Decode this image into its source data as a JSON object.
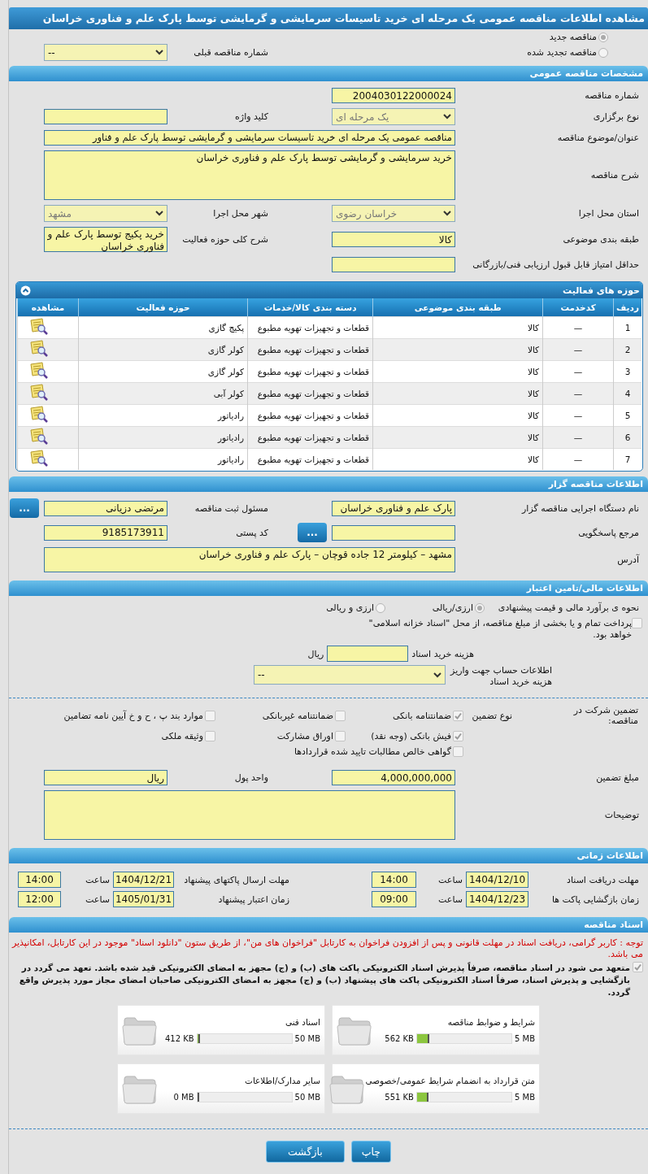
{
  "title": "مشاهده اطلاعات مناقصه عمومی یک مرحله ای خرید تاسیسات سرمایشی و گرمایشی توسط پارک علم و فناوری خراسان",
  "tender_type": {
    "options": [
      {
        "label": "مناقصه جدید",
        "selected": true
      },
      {
        "label": "مناقصه تجدید شده",
        "selected": false
      }
    ],
    "previous_number": {
      "label": "شماره مناقصه قبلی",
      "value": "--",
      "kind": "select",
      "disabled": false
    }
  },
  "general": {
    "header": "مشخصات مناقصه عمومی",
    "rows": [
      {
        "right": {
          "label": "شماره مناقصه",
          "value": "2004030122000024",
          "kind": "input"
        }
      },
      {
        "right": {
          "label": "نوع برگزاری",
          "value": "یک مرحله ای",
          "kind": "select",
          "disabled": true
        },
        "left": {
          "label": "کلید واژه",
          "kind": "input"
        }
      },
      {
        "right": {
          "label": "عنوان/موضوع مناقصه",
          "value": "مناقصه عمومی یک مرحله ای خرید تاسیسات سرمایشی و گرمایشی توسط پارک علم و فناور",
          "kind": "wide-input"
        }
      },
      {
        "right": {
          "label": "شرح مناقصه",
          "value": "خرید سرمایشی و گرمایشی توسط پارک علم و فناوری خراسان",
          "kind": "wide-textarea"
        }
      },
      {
        "right": {
          "label": "استان محل اجرا",
          "value": "خراسان رضوی",
          "kind": "select",
          "disabled": true
        },
        "left": {
          "label": "شهر محل اجرا",
          "value": "مشهد",
          "kind": "select",
          "disabled": true
        }
      },
      {
        "right": {
          "label": "طبقه بندی موضوعی",
          "value": "کالا",
          "kind": "input"
        },
        "left": {
          "label": "شرح کلی حوزه فعالیت",
          "value": "خرید پکیج توسط پارک علم و فناوری خراسان",
          "kind": "textarea"
        }
      },
      {
        "right": {
          "label": "حداقل امتیاز قابل قبول ارزیابی فنی/بازرگانی",
          "kind": "input"
        }
      }
    ]
  },
  "activities": {
    "header": "حوزه های فعالیت",
    "columns": [
      "ردیف",
      "کدخدمت",
      "طبقه بندی موضوعی",
      "دسته بندی کالا/خدمات",
      "حوزه فعالیت",
      "مشاهده"
    ],
    "rows": [
      {
        "row": "1",
        "service_code": "—",
        "category": "کالا",
        "group": "قطعات و تجهیزات تهویه مطبوع",
        "activity": "پکیج گازی"
      },
      {
        "row": "2",
        "service_code": "—",
        "category": "کالا",
        "group": "قطعات و تجهیزات تهویه مطبوع",
        "activity": "کولر گازی"
      },
      {
        "row": "3",
        "service_code": "—",
        "category": "کالا",
        "group": "قطعات و تجهیزات تهویه مطبوع",
        "activity": "کولر گازی"
      },
      {
        "row": "4",
        "service_code": "—",
        "category": "کالا",
        "group": "قطعات و تجهیزات تهویه مطبوع",
        "activity": "کولر آبی"
      },
      {
        "row": "5",
        "service_code": "—",
        "category": "کالا",
        "group": "قطعات و تجهیزات تهویه مطبوع",
        "activity": "رادیاتور"
      },
      {
        "row": "6",
        "service_code": "—",
        "category": "کالا",
        "group": "قطعات و تجهیزات تهویه مطبوع",
        "activity": "رادیاتور"
      },
      {
        "row": "7",
        "service_code": "—",
        "category": "کالا",
        "group": "قطعات و تجهیزات تهویه مطبوع",
        "activity": "رادیاتور"
      }
    ]
  },
  "tenderer": {
    "header": "اطلاعات مناقصه گزار",
    "rows": [
      {
        "right": {
          "label": "نام دستگاه اجرایی مناقصه گزار",
          "value": "پارک علم و فناوری خراسان",
          "kind": "input"
        },
        "left": {
          "label": "مسئول ثبت مناقصه",
          "value": "مرتضی دزیانی",
          "kind": "input",
          "button": "..."
        }
      },
      {
        "right": {
          "label": "مرجع پاسخگویی",
          "kind": "input",
          "button": "..."
        },
        "left": {
          "label": "کد پستی",
          "value": "9185173911",
          "kind": "input"
        }
      },
      {
        "right": {
          "label": "آدرس",
          "value": "مشهد – کیلومتر 12 جاده قوچان – پارک علم و فناوری خراسان",
          "kind": "wide-note"
        }
      }
    ]
  },
  "financial": {
    "header": "اطلاعات مالی/تامین اعتبار",
    "estimate": {
      "label": "نحوه ی برآورد مالی و قیمت پیشنهادی",
      "options": [
        {
          "label": "ارزی/ریالی",
          "selected": true
        },
        {
          "label": "ارزی و ریالی",
          "selected": false
        }
      ]
    },
    "treasury": {
      "label": "پرداخت تمام و یا بخشی از مبلغ مناقصه، از محل \"اسناد خزانه اسلامی\" خواهد بود.",
      "checked": false
    },
    "doc_cost": {
      "label": "هزینه خرید اسناد",
      "unit": "ریال"
    },
    "account": {
      "label": "اطلاعات حساب جهت واریز هزینه خرید اسناد",
      "value": "--",
      "kind": "select",
      "disabled": false
    }
  },
  "guarantee": {
    "label": "تضمین شرکت در مناقصه:",
    "type_label": "نوع تضمین",
    "options": [
      {
        "label": "ضمانتنامه بانکی",
        "checked": true
      },
      {
        "label": "ضمانتنامه غیربانکی",
        "checked": false
      },
      {
        "label": "موارد بند پ ، ح و خ آیین نامه تضامین",
        "checked": false
      },
      {
        "label": "فیش بانکی (وجه نقد)",
        "checked": true
      },
      {
        "label": "اوراق مشارکت",
        "checked": false
      },
      {
        "label": "وثیقه ملکی",
        "checked": false
      },
      {
        "label": "گواهی خالص مطالبات تایید شده قراردادها",
        "checked": false
      }
    ],
    "rows": [
      {
        "right": {
          "label": "مبلغ تضمین",
          "value": "4,000,000,000",
          "kind": "input"
        },
        "left": {
          "label": "واحد پول",
          "value": "ریال",
          "kind": "input"
        }
      },
      {
        "right": {
          "label": "توضیحات",
          "kind": "wide-textarea"
        }
      }
    ]
  },
  "timing": {
    "header": "اطلاعات زمانی",
    "items": [
      {
        "label": "مهلت دریافت اسناد",
        "date": "1404/12/10",
        "time_label": "ساعت",
        "time": "14:00"
      },
      {
        "label": "مهلت ارسال پاکتهای پیشنهاد",
        "date": "1404/12/21",
        "time_label": "ساعت",
        "time": "14:00"
      },
      {
        "label": "زمان بازگشایی پاکت ها",
        "date": "1404/12/23",
        "time_label": "ساعت",
        "time": "09:00"
      },
      {
        "label": "زمان اعتبار پیشنهاد",
        "date": "1405/01/31",
        "time_label": "ساعت",
        "time": "12:00"
      }
    ]
  },
  "documents": {
    "header": "اسناد مناقصه",
    "notice": "توجه : کاربر گرامی، دریافت اسناد در مهلت قانونی و پس از افزودن فراخوان به کارتابل \"فراخوان های من\"، از طریق ستون \"دانلود اسناد\" موجود در این کارتابل، امکانپذیر می باشد.",
    "commitment": {
      "text": "متعهد می شود در اسناد مناقصه، صرفاً پذیرش اسناد الکترونیکی پاکت های (ب) و (ج) مجهز به امضای الکترونیکی قید شده باشد. تعهد می گردد در بازگشایی و پذیرش اسناد، صرفاً اسناد الکترونیکی پاکت های پیشنهاد (ب) و (ج) مجهز به امضای الکترونیکی صاحبان امضای مجاز مورد پذیرش واقع گردد.",
      "checked": true
    },
    "files": [
      {
        "name": "شرایط و ضوابط مناقصه",
        "max": "5 MB",
        "used": "562 KB",
        "level": 0.11
      },
      {
        "name": "اسناد فنی",
        "max": "50 MB",
        "used": "412 KB",
        "level": 0.008
      },
      {
        "name": "متن قرارداد به انضمام شرایط عمومی/خصوصی",
        "max": "5 MB",
        "used": "551 KB",
        "level": 0.108
      },
      {
        "name": "سایر مدارک/اطلاعات",
        "max": "50 MB",
        "used": "0 MB",
        "level": 0
      }
    ]
  },
  "buttons": [
    {
      "label": "چاپ"
    },
    {
      "label": "بازگشت"
    }
  ]
}
